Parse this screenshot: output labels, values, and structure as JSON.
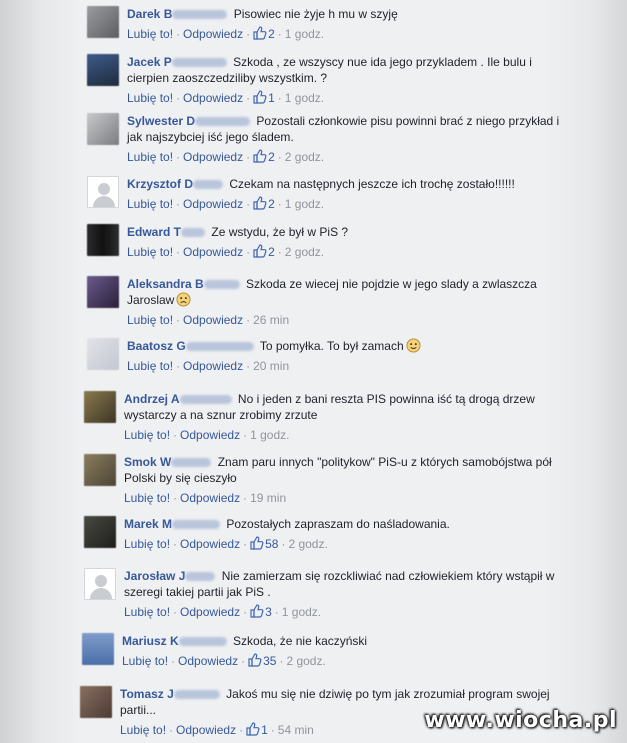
{
  "actions": {
    "like": "Lubię to!",
    "reply": "Odpowiedz"
  },
  "watermark": "www.wiocha.pl",
  "comments": [
    {
      "name": "Darek B",
      "text": "Pisowiec nie żyje h   mu w szyję",
      "likes": "2",
      "time": "1 godz."
    },
    {
      "name": "Jacek P",
      "text": "Szkoda , ze wszyscy nue ida jego przykladem . Ile bulu i cierpien zaoszczedziliby wszystkim. ?",
      "likes": "1",
      "time": "1 godz."
    },
    {
      "name": "Sylwester D",
      "text": "Pozostali członkowie pisu powinni brać z niego przykład i jak najszybciej iść jego śladem.",
      "likes": "2",
      "time": "2 godz."
    },
    {
      "name": "Krzysztof D",
      "text": "Czekam na następnych jeszcze ich trochę zostało!!!!!!",
      "likes": "2",
      "time": "1 godz."
    },
    {
      "name": "Edward T",
      "text": "Ze wstydu, że był w PiS ?",
      "likes": "2",
      "time": "2 godz."
    },
    {
      "name": "Aleksandra B",
      "text": "Szkoda ze wiecej nie pojdzie w jego slady a zwlaszcza Jaroslaw",
      "likes": "",
      "time": "26 min"
    },
    {
      "name": "Baatosz G",
      "text": "To pomyłka. To był zamach",
      "likes": "",
      "time": "20 min"
    },
    {
      "name": "Andrzej A",
      "text": "No i jeden z bani reszta PIS powinna iść tą drogą drzew wystarczy a na sznur zrobimy zrzute",
      "likes": "",
      "time": "1 godz."
    },
    {
      "name": "Smok W",
      "text": "Znam paru innych \"politykow\" PiS-u z których samobójstwa pół Polski by się cieszyło",
      "likes": "",
      "time": "19 min"
    },
    {
      "name": "Marek M",
      "text": "Pozostałych zapraszam do naśladowania.",
      "likes": "58",
      "time": "2 godz."
    },
    {
      "name": "Jarosław J",
      "text": "Nie zamierzam się rozckliwiać nad człowiekiem który wstąpił w szeregi takiej partii jak PiS .",
      "likes": "3",
      "time": "1 godz."
    },
    {
      "name": "Mariusz K",
      "text": "Szkoda, że nie kaczyński",
      "likes": "35",
      "time": "2 godz."
    },
    {
      "name": "Tomasz J",
      "text": "Jakoś mu się nie dziwię po tym jak zrozumiał program swojej partii...",
      "likes": "1",
      "time": "54 min"
    }
  ]
}
